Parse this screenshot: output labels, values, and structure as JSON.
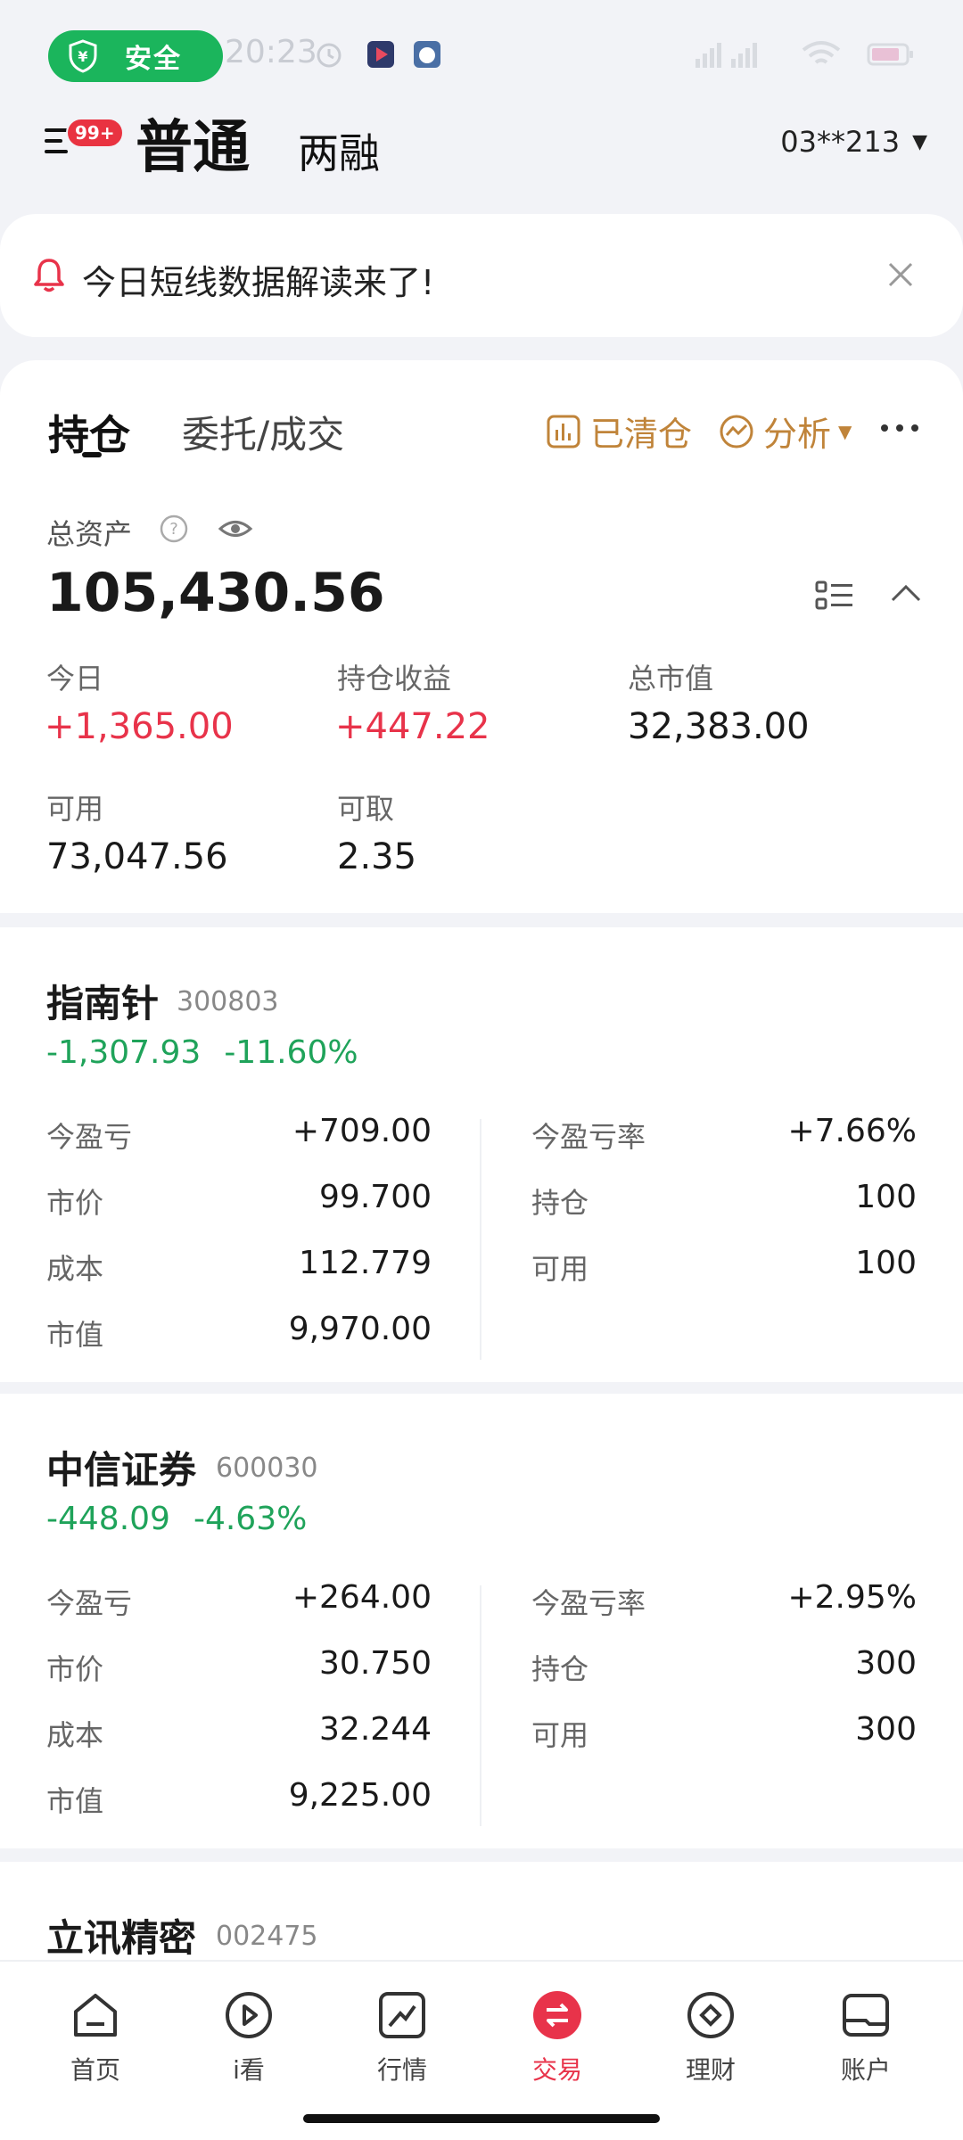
{
  "status_bar": {
    "time": "20:23",
    "safe_label": "安全"
  },
  "header": {
    "badge": "99+",
    "tab_active": "普通",
    "tab_other": "两融",
    "account": "03**213"
  },
  "notice": {
    "text": "今日短线数据解读来了!"
  },
  "panel": {
    "tabs": [
      "持仓",
      "委托/成交"
    ],
    "actions": [
      "已清仓",
      "分析"
    ],
    "total_label": "总资产",
    "total_value": "105,430.56",
    "stats": [
      {
        "label": "今日",
        "value": "+1,365.00"
      },
      {
        "label": "持仓收益",
        "value": "+447.22"
      },
      {
        "label": "总市值",
        "value": "32,383.00"
      },
      {
        "label": "可用",
        "value": "73,047.56"
      },
      {
        "label": "可取",
        "value": "2.35"
      }
    ]
  },
  "holdings": [
    {
      "name": "指南针",
      "code": "300803",
      "pnl": "-1,307.93",
      "pnl_pct": "-11.60%",
      "left": [
        {
          "label": "今盈亏",
          "value": "+709.00"
        },
        {
          "label": "市价",
          "value": "99.700"
        },
        {
          "label": "成本",
          "value": "112.779"
        },
        {
          "label": "市值",
          "value": "9,970.00"
        }
      ],
      "right": [
        {
          "label": "今盈亏率",
          "value": "+7.66%"
        },
        {
          "label": "持仓",
          "value": "100"
        },
        {
          "label": "可用",
          "value": "100"
        }
      ]
    },
    {
      "name": "中信证券",
      "code": "600030",
      "pnl": "-448.09",
      "pnl_pct": "-4.63%",
      "left": [
        {
          "label": "今盈亏",
          "value": "+264.00"
        },
        {
          "label": "市价",
          "value": "30.750"
        },
        {
          "label": "成本",
          "value": "32.244"
        },
        {
          "label": "市值",
          "value": "9,225.00"
        }
      ],
      "right": [
        {
          "label": "今盈亏率",
          "value": "+2.95%"
        },
        {
          "label": "持仓",
          "value": "300"
        },
        {
          "label": "可用",
          "value": "300"
        }
      ]
    },
    {
      "name": "立讯精密",
      "code": "002475"
    }
  ],
  "nav": [
    "首页",
    "i看",
    "行情",
    "交易",
    "理财",
    "账户"
  ],
  "colors": {
    "up": "#e8334a",
    "down": "#1fa35a",
    "accent": "#c0843a",
    "safe": "#1bb55c"
  }
}
